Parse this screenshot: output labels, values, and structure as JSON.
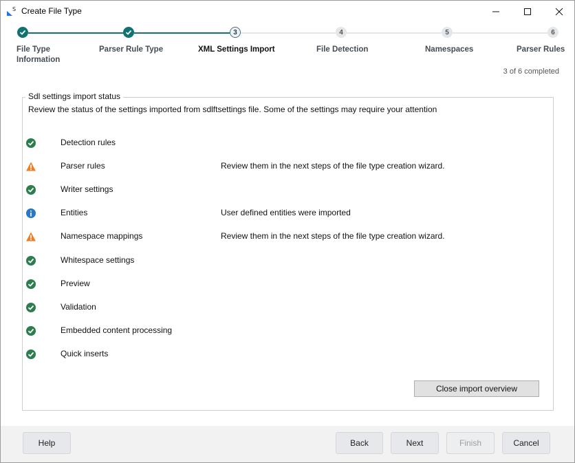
{
  "window": {
    "title": "Create File Type",
    "app_icon": "sdl-logo-icon",
    "controls": [
      "minimize-icon",
      "maximize-icon",
      "close-icon"
    ]
  },
  "stepper": {
    "steps": [
      {
        "number": "1",
        "label": "File Type\nInformation",
        "state": "done"
      },
      {
        "number": "2",
        "label": "Parser Rule Type",
        "state": "done"
      },
      {
        "number": "3",
        "label": "XML Settings Import",
        "state": "current"
      },
      {
        "number": "4",
        "label": "File Detection",
        "state": "future"
      },
      {
        "number": "5",
        "label": "Namespaces",
        "state": "future"
      },
      {
        "number": "6",
        "label": "Parser Rules",
        "state": "future"
      }
    ],
    "progress_text": "3 of 6 completed",
    "completed_count": 3,
    "total_count": 6
  },
  "import_status": {
    "group_title": "Sdl settings import status",
    "description": "Review the status of the settings imported from sdlftsettings file. Some of the settings may require your attention",
    "items": [
      {
        "name": "Detection rules",
        "status": "success",
        "message": ""
      },
      {
        "name": "Parser rules",
        "status": "warning",
        "message": "Review them in the next steps of the file type creation wizard."
      },
      {
        "name": "Writer settings",
        "status": "success",
        "message": ""
      },
      {
        "name": "Entities",
        "status": "info",
        "message": "User defined entities were imported"
      },
      {
        "name": "Namespace mappings",
        "status": "warning",
        "message": "Review them in the next steps of the file type creation wizard."
      },
      {
        "name": "Whitespace settings",
        "status": "success",
        "message": ""
      },
      {
        "name": "Preview",
        "status": "success",
        "message": ""
      },
      {
        "name": "Validation",
        "status": "success",
        "message": ""
      },
      {
        "name": "Embedded content processing",
        "status": "success",
        "message": ""
      },
      {
        "name": "Quick inserts",
        "status": "success",
        "message": ""
      }
    ],
    "close_button": "Close import overview"
  },
  "footer": {
    "help": "Help",
    "back": "Back",
    "next": "Next",
    "finish": "Finish",
    "cancel": "Cancel"
  },
  "colors": {
    "step_done": "#0f7371",
    "step_track": "#0f7371",
    "step_track_future": "#e4e7ea",
    "success": "#2e7d4f",
    "warning": "#e8802a",
    "info": "#2b78c2"
  }
}
